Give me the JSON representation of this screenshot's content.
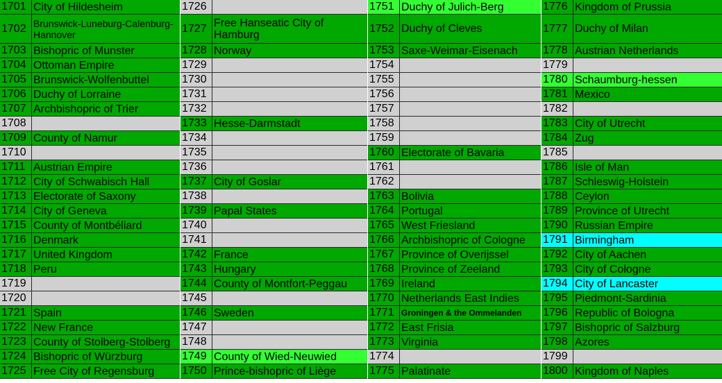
{
  "colors": {
    "green": "#00a800",
    "light_green": "#33ff33",
    "gray": "#d0d0d0",
    "cyan": "#00ffff"
  },
  "columns": [
    [
      {
        "year": "1701",
        "name": "City of Hildesheim",
        "color": "green"
      },
      {
        "year": "1702",
        "name": "Brunswick-Luneburg-Calenburg-Hannover",
        "color": "green",
        "tall": true,
        "small": true
      },
      {
        "year": "1703",
        "name": "Bishopric of Munster",
        "color": "green"
      },
      {
        "year": "1704",
        "name": "Ottoman Empire",
        "color": "green"
      },
      {
        "year": "1705",
        "name": "Brunswick-Wolfenbuttel",
        "color": "green"
      },
      {
        "year": "1706",
        "name": "Duchy of Lorraine",
        "color": "green"
      },
      {
        "year": "1707",
        "name": "Archbishopric of Trier",
        "color": "green"
      },
      {
        "year": "1708",
        "name": "",
        "color": "gray"
      },
      {
        "year": "1709",
        "name": "County of Namur",
        "color": "green"
      },
      {
        "year": "1710",
        "name": "",
        "color": "gray"
      },
      {
        "year": "1711",
        "name": "Austrian Empire",
        "color": "green"
      },
      {
        "year": "1712",
        "name": "City of Schwabisch Hall",
        "color": "green"
      },
      {
        "year": "1713",
        "name": "Electorate of Saxony",
        "color": "green"
      },
      {
        "year": "1714",
        "name": "City of Geneva",
        "color": "green"
      },
      {
        "year": "1715",
        "name": "County of Montbéliard",
        "color": "green"
      },
      {
        "year": "1716",
        "name": "Denmark",
        "color": "green"
      },
      {
        "year": "1717",
        "name": "United Kingdom",
        "color": "green"
      },
      {
        "year": "1718",
        "name": "Peru",
        "color": "green"
      },
      {
        "year": "1719",
        "name": "",
        "color": "gray"
      },
      {
        "year": "1720",
        "name": "",
        "color": "gray"
      },
      {
        "year": "1721",
        "name": "Spain",
        "color": "green"
      },
      {
        "year": "1722",
        "name": "New France",
        "color": "green"
      },
      {
        "year": "1723",
        "name": "County of Stolberg-Stolberg",
        "color": "green"
      },
      {
        "year": "1724",
        "name": "Bishopric of Würzburg",
        "color": "green"
      },
      {
        "year": "1725",
        "name": "Free City of Regensburg",
        "color": "green"
      }
    ],
    [
      {
        "year": "1726",
        "name": "",
        "color": "gray"
      },
      {
        "year": "1727",
        "name": "Free Hanseatic City of Hamburg",
        "color": "green",
        "tall": true
      },
      {
        "year": "1728",
        "name": "Norway",
        "color": "green"
      },
      {
        "year": "1729",
        "name": "",
        "color": "gray"
      },
      {
        "year": "1730",
        "name": "",
        "color": "gray"
      },
      {
        "year": "1731",
        "name": "",
        "color": "gray"
      },
      {
        "year": "1732",
        "name": "",
        "color": "gray"
      },
      {
        "year": "1733",
        "name": "Hesse-Darmstadt",
        "color": "green"
      },
      {
        "year": "1734",
        "name": "",
        "color": "gray"
      },
      {
        "year": "1735",
        "name": "",
        "color": "gray"
      },
      {
        "year": "1736",
        "name": "",
        "color": "gray"
      },
      {
        "year": "1737",
        "name": "City of Goslar",
        "color": "green"
      },
      {
        "year": "1738",
        "name": "",
        "color": "gray"
      },
      {
        "year": "1739",
        "name": "Papal States",
        "color": "green"
      },
      {
        "year": "1740",
        "name": "",
        "color": "gray"
      },
      {
        "year": "1741",
        "name": "",
        "color": "gray"
      },
      {
        "year": "1742",
        "name": "France",
        "color": "green"
      },
      {
        "year": "1743",
        "name": "Hungary",
        "color": "green"
      },
      {
        "year": "1744",
        "name": "County of Montfort-Peggau",
        "color": "green"
      },
      {
        "year": "1745",
        "name": "",
        "color": "gray"
      },
      {
        "year": "1746",
        "name": "Sweden",
        "color": "green"
      },
      {
        "year": "1747",
        "name": "",
        "color": "gray"
      },
      {
        "year": "1748",
        "name": "",
        "color": "gray"
      },
      {
        "year": "1749",
        "name": "County of Wied-Neuwied",
        "color": "light_green"
      },
      {
        "year": "1750",
        "name": "Prince-bishopric of Liège",
        "color": "green"
      }
    ],
    [
      {
        "year": "1751",
        "name": "Duchy of Julich-Berg",
        "color": "light_green"
      },
      {
        "year": "1752",
        "name": "Duchy of Cleves",
        "color": "green",
        "tall": true
      },
      {
        "year": "1753",
        "name": "Saxe-Weimar-Eisenach",
        "color": "green"
      },
      {
        "year": "1754",
        "name": "",
        "color": "gray"
      },
      {
        "year": "1755",
        "name": "",
        "color": "gray"
      },
      {
        "year": "1756",
        "name": "",
        "color": "gray"
      },
      {
        "year": "1757",
        "name": "",
        "color": "gray"
      },
      {
        "year": "1758",
        "name": "",
        "color": "gray"
      },
      {
        "year": "1759",
        "name": "",
        "color": "gray"
      },
      {
        "year": "1760",
        "name": "Electorate of Bavaria",
        "color": "green"
      },
      {
        "year": "1761",
        "name": "",
        "color": "gray"
      },
      {
        "year": "1762",
        "name": "",
        "color": "gray"
      },
      {
        "year": "1763",
        "name": "Bolivia",
        "color": "green"
      },
      {
        "year": "1764",
        "name": "Portugal",
        "color": "green"
      },
      {
        "year": "1765",
        "name": "West Friesland",
        "color": "green"
      },
      {
        "year": "1766",
        "name": "Archbishopric of Cologne",
        "color": "green"
      },
      {
        "year": "1767",
        "name": "Province of Overijssel",
        "color": "green"
      },
      {
        "year": "1768",
        "name": "Province of Zeeland",
        "color": "green"
      },
      {
        "year": "1769",
        "name": "Ireland",
        "color": "green"
      },
      {
        "year": "1770",
        "name": "Netherlands East Indies",
        "color": "green"
      },
      {
        "year": "1771",
        "name": "Groningen & the Ommelanden",
        "color": "green",
        "tiny": true
      },
      {
        "year": "1772",
        "name": "East Frisia",
        "color": "green"
      },
      {
        "year": "1773",
        "name": "Virginia",
        "color": "green"
      },
      {
        "year": "1774",
        "name": "",
        "color": "gray"
      },
      {
        "year": "1775",
        "name": "Palatinate",
        "color": "green"
      }
    ],
    [
      {
        "year": "1776",
        "name": "Kingdom of Prussia",
        "color": "green"
      },
      {
        "year": "1777",
        "name": "Duchy of Milan",
        "color": "green",
        "tall": true
      },
      {
        "year": "1778",
        "name": "Austrian Netherlands",
        "color": "green"
      },
      {
        "year": "1779",
        "name": "",
        "color": "gray"
      },
      {
        "year": "1780",
        "name": "Schaumburg-hessen",
        "color": "light_green"
      },
      {
        "year": "1781",
        "name": "Mexico",
        "color": "green"
      },
      {
        "year": "1782",
        "name": "",
        "color": "gray"
      },
      {
        "year": "1783",
        "name": "City of Utrecht",
        "color": "green"
      },
      {
        "year": "1784",
        "name": "Zug",
        "color": "green"
      },
      {
        "year": "1785",
        "name": "",
        "color": "gray"
      },
      {
        "year": "1786",
        "name": "Isle of Man",
        "color": "green"
      },
      {
        "year": "1787",
        "name": "Schleswig-Holstein",
        "color": "green"
      },
      {
        "year": "1788",
        "name": "Ceylon",
        "color": "green"
      },
      {
        "year": "1789",
        "name": "Province of Utrecht",
        "color": "green"
      },
      {
        "year": "1790",
        "name": "Russian Empire",
        "color": "green"
      },
      {
        "year": "1791",
        "name": "Birmingham",
        "color": "cyan"
      },
      {
        "year": "1792",
        "name": "City of Aachen",
        "color": "green"
      },
      {
        "year": "1793",
        "name": "City of Cologne",
        "color": "green"
      },
      {
        "year": "1794",
        "name": "City of Lancaster",
        "color": "cyan"
      },
      {
        "year": "1795",
        "name": "Piedmont-Sardinia",
        "color": "green"
      },
      {
        "year": "1796",
        "name": "Republic of Bologna",
        "color": "green"
      },
      {
        "year": "1797",
        "name": "Bishopric of Salzburg",
        "color": "green"
      },
      {
        "year": "1798",
        "name": "Azores",
        "color": "green"
      },
      {
        "year": "1799",
        "name": "",
        "color": "gray"
      },
      {
        "year": "1800",
        "name": "Kingdom of Naples",
        "color": "green"
      }
    ]
  ]
}
